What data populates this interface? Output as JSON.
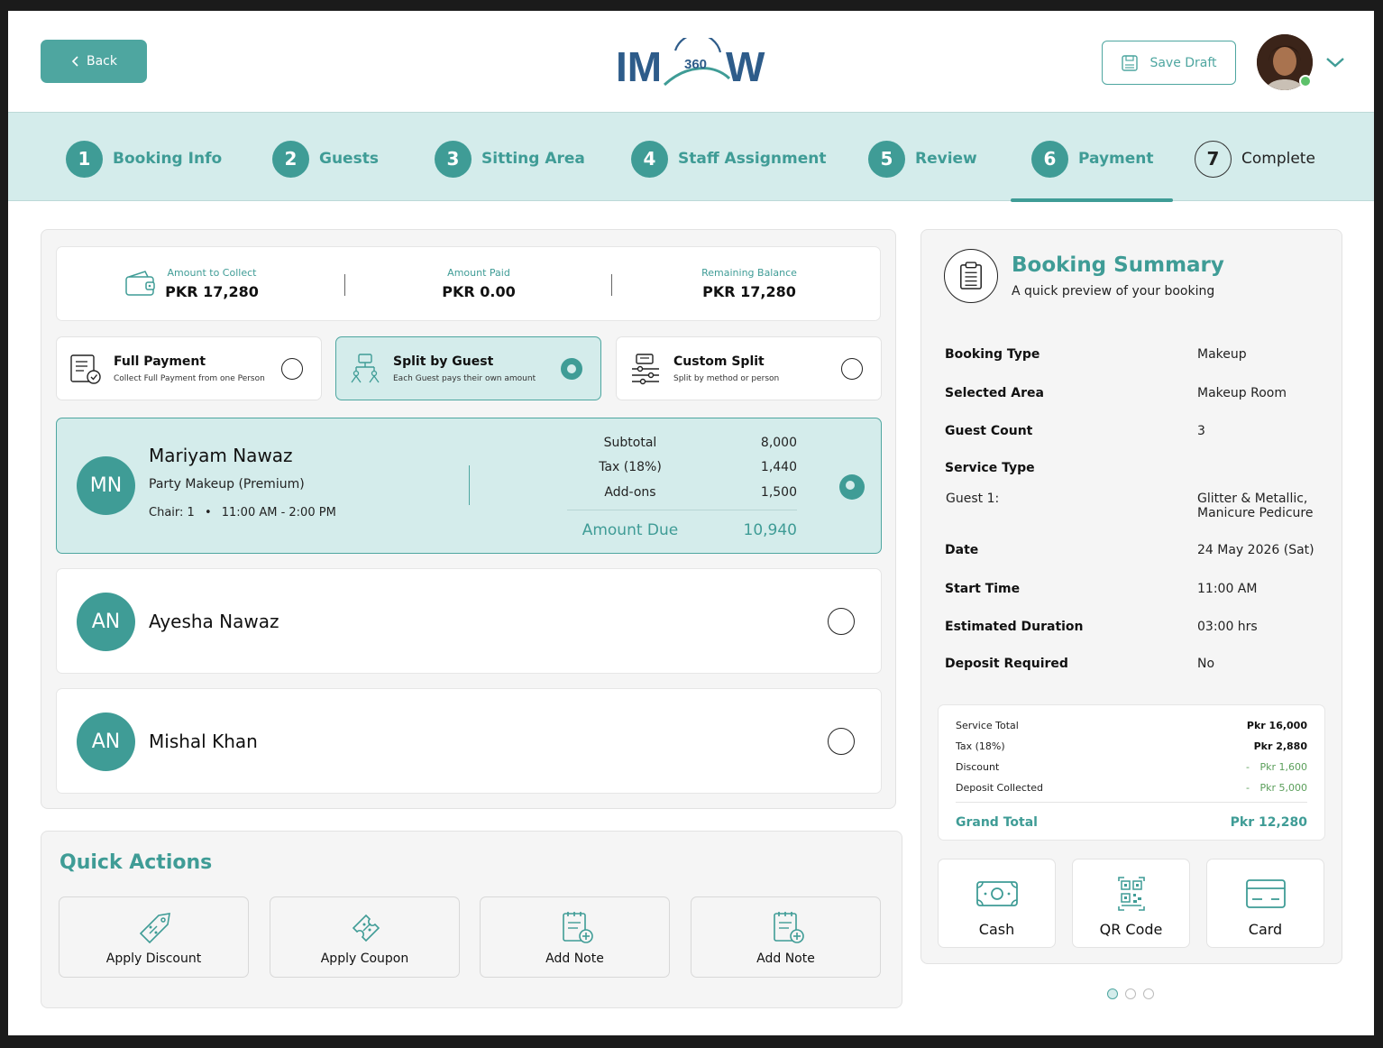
{
  "header": {
    "back_label": "Back",
    "logo_text_left": "IM",
    "logo_badge": "360",
    "logo_text_right": "W",
    "save_draft_label": "Save Draft",
    "user_status": "online"
  },
  "steps": [
    {
      "num": "1",
      "label": "Booking Info",
      "state": "done"
    },
    {
      "num": "2",
      "label": "Guests",
      "state": "done"
    },
    {
      "num": "3",
      "label": "Sitting Area",
      "state": "done"
    },
    {
      "num": "4",
      "label": "Staff Assignment",
      "state": "done"
    },
    {
      "num": "5",
      "label": "Review",
      "state": "done"
    },
    {
      "num": "6",
      "label": "Payment",
      "state": "active"
    },
    {
      "num": "7",
      "label": "Complete",
      "state": "pending"
    }
  ],
  "amounts": {
    "to_collect": {
      "label": "Amount to Collect",
      "value": "PKR 17,280"
    },
    "paid": {
      "label": "Amount Paid",
      "value": "PKR 0.00"
    },
    "remaining": {
      "label": "Remaining Balance",
      "value": "PKR 17,280"
    }
  },
  "payment_options": [
    {
      "title": "Full Payment",
      "subtitle": "Collect Full Payment from one Person",
      "selected": false
    },
    {
      "title": "Split by Guest",
      "subtitle": "Each Guest pays their own amount",
      "selected": true
    },
    {
      "title": "Custom Split",
      "subtitle": "Split by method or person",
      "selected": false
    }
  ],
  "guests": [
    {
      "initials": "MN",
      "name": "Mariyam Nawaz",
      "service": "Party Makeup (Premium)",
      "chair": "Chair: 1",
      "bullet": "•",
      "time": "11:00 AM - 2:00 PM",
      "subtotal_label": "Subtotal",
      "subtotal": "8,000",
      "tax_label": "Tax (18%)",
      "tax": "1,440",
      "addons_label": "Add-ons",
      "addons": "1,500",
      "due_label": "Amount Due",
      "due": "10,940",
      "selected": true
    },
    {
      "initials": "AN",
      "name": "Ayesha Nawaz",
      "selected": false
    },
    {
      "initials": "AN",
      "name": "Mishal Khan",
      "selected": false
    }
  ],
  "quick_actions": {
    "title": "Quick Actions",
    "items": [
      {
        "label": "Apply Discount",
        "icon": "discount-tag-icon"
      },
      {
        "label": "Apply Coupon",
        "icon": "coupon-icon"
      },
      {
        "label": "Add Note",
        "icon": "note-add-icon"
      },
      {
        "label": "Add Note",
        "icon": "note-add-icon"
      }
    ]
  },
  "summary": {
    "title": "Booking Summary",
    "subtitle": "A quick preview of your booking",
    "rows": [
      {
        "key": "Booking Type",
        "value": "Makeup"
      },
      {
        "key": "Selected Area",
        "value": "Makeup Room"
      },
      {
        "key": "Guest Count",
        "value": "3"
      },
      {
        "key": "Service Type",
        "value": ""
      },
      {
        "key": "Guest 1:",
        "value": "Glitter & Metallic,",
        "value2": "Manicure Pedicure"
      },
      {
        "key": "Date",
        "value": "24 May 2026 (Sat)"
      },
      {
        "key": "Start Time",
        "value": "11:00 AM"
      },
      {
        "key": "Estimated Duration",
        "value": "03:00 hrs"
      },
      {
        "key": "Deposit Required",
        "value": "No"
      }
    ],
    "totals": {
      "service_total_label": "Service Total",
      "service_total": "Pkr 16,000",
      "tax_label": "Tax (18%)",
      "tax": "Pkr 2,880",
      "discount_label": "Discount",
      "discount": "Pkr 1,600",
      "deposit_label": "Deposit Collected",
      "deposit": "Pkr 5,000",
      "minus": "-",
      "grand_label": "Grand Total",
      "grand": "Pkr 12,280"
    },
    "methods": [
      {
        "label": "Cash",
        "icon": "cash-icon"
      },
      {
        "label": "QR Code",
        "icon": "qr-code-icon"
      },
      {
        "label": "Card",
        "icon": "card-icon"
      }
    ]
  },
  "pagination": {
    "count": 3,
    "active": 1
  },
  "colors": {
    "accent": "#3f9c96",
    "accent_light": "#d4eceb",
    "success": "#5dc16a"
  }
}
